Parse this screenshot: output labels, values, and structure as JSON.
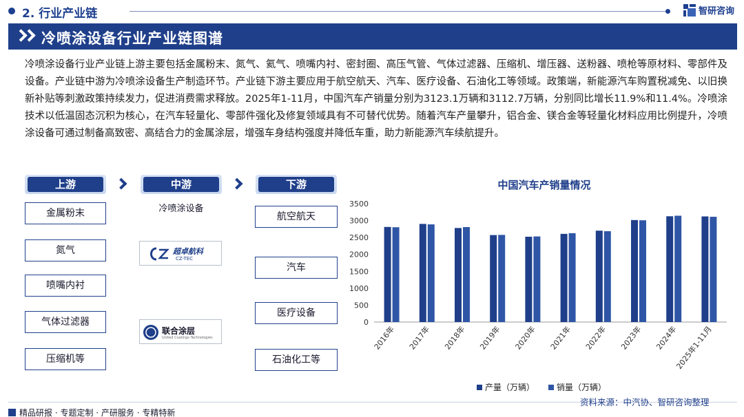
{
  "header": {
    "section": "2. 行业产业链",
    "brand": "智研咨询",
    "title": "冷喷涂设备行业产业链图谱"
  },
  "paragraph": "冷喷涂设备行业产业链上游主要包括金属粉末、氮气、氦气、喷嘴内衬、密封圈、高压气管、气体过滤器、压缩机、增压器、送粉器、喷枪等原材料、零部件及设备。产业链中游为冷喷涂设备生产制造环节。产业链下游主要应用于航空航天、汽车、医疗设备、石油化工等领域。政策端，新能源汽车购置税减免、以旧换新补贴等刺激政策持续发力，促进消费需求释放。2025年1-11月，中国汽车产销量分别为3123.1万辆和3112.7万辆，分别同比增长11.9%和11.4%。冷喷涂技术以低温固态沉积为核心，在汽车轻量化、零部件强化及修复领域具有不可替代优势。随着汽车产量攀升，铝合金、镁合金等轻量化材料应用比例提升，冷喷涂设备可通过制备高致密、高结合力的金属涂层，增强车身结构强度并降低车重，助力新能源汽车续航提升。",
  "chain": {
    "upstream": {
      "label": "上游",
      "items": [
        "金属粉末",
        "氮气",
        "喷嘴内衬",
        "气体过滤器",
        "压缩机等"
      ]
    },
    "midstream": {
      "label": "中游",
      "caption": "冷喷涂设备",
      "companies": [
        {
          "name": "超卓航科",
          "sub": "CZ-TEC"
        },
        {
          "name": "联合涂层",
          "sub": "United Coatings Technologies"
        }
      ]
    },
    "downstream": {
      "label": "下游",
      "items": [
        "航空航天",
        "汽车",
        "医疗设备",
        "石油化工等"
      ]
    }
  },
  "chart_data": {
    "type": "bar",
    "title": "中国汽车产销量情况",
    "categories": [
      "2016年",
      "2017年",
      "2018年",
      "2019年",
      "2020年",
      "2021年",
      "2022年",
      "2023年",
      "2024年",
      "2025年1-11月"
    ],
    "series": [
      {
        "name": "产量（万辆）",
        "color": "#1f3f8a",
        "values": [
          2812,
          2902,
          2781,
          2572,
          2523,
          2608,
          2702,
          3016,
          3128,
          3123.1
        ]
      },
      {
        "name": "销量（万辆）",
        "color": "#2f56a6",
        "values": [
          2803,
          2888,
          2808,
          2577,
          2531,
          2628,
          2686,
          3009,
          3144,
          3112.7
        ]
      }
    ],
    "ylim": [
      0,
      3500
    ],
    "yticks": [
      0,
      500,
      1000,
      1500,
      2000,
      2500,
      3000,
      3500
    ],
    "grid": false,
    "legend": "bottom"
  },
  "source": "资料来源：中汽协、智研咨询整理",
  "footer": "精品研报 · 专题定制 · 产研服务 · 专精特新"
}
